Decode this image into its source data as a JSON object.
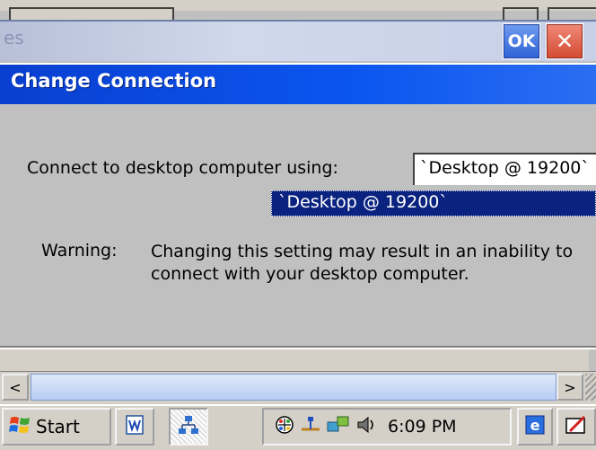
{
  "window": {
    "title_fragment": "es",
    "ok_label": "OK",
    "close_label": "✕"
  },
  "dialog": {
    "title": "Change Connection",
    "connect_label": "Connect to desktop computer using:",
    "combo_value": "`Desktop @ 19200`",
    "dropdown_selected": "`Desktop @ 19200`",
    "warning_label": "Warning:",
    "warning_text": "Changing this setting may result in an inability to\nconnect with your desktop computer."
  },
  "scrollbar": {
    "left_arrow": "<",
    "right_arrow": ">"
  },
  "taskbar": {
    "start_label": "Start",
    "clock": "6:09 PM",
    "icons": [
      "windows-flag-icon",
      "word-document-icon",
      "network-icon",
      "input-panel-icon",
      "usb-icon",
      "connection-icon",
      "speaker-icon",
      "ie-icon",
      "keyboard-pen-icon"
    ]
  },
  "colors": {
    "dialog_header": "#0b56f0",
    "selection": "#0a2280",
    "ok_button": "#2e62d6",
    "close_button": "#d44a32"
  }
}
